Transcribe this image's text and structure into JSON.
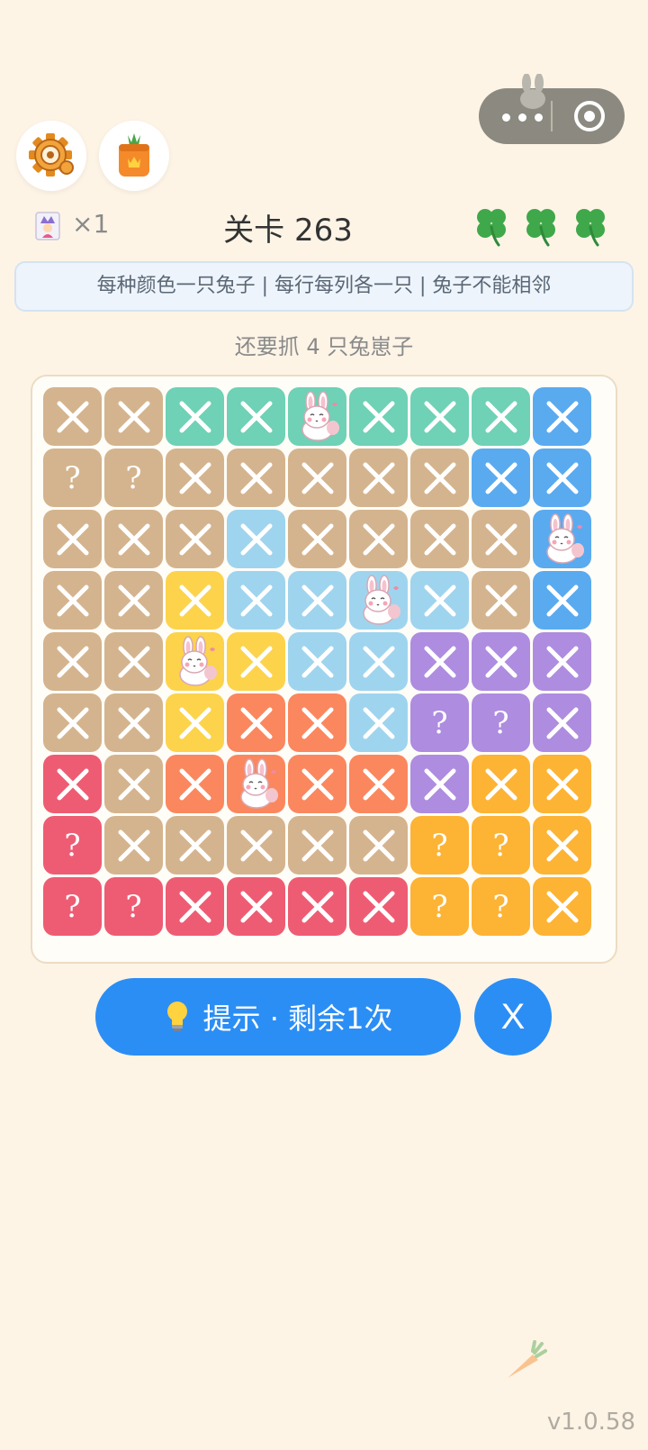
{
  "header": {
    "joker_count": "×1",
    "level_title": "关卡 263",
    "lives": 3
  },
  "rules": "每种颜色一只兔子 | 每行每列各一只 | 兔子不能相邻",
  "remaining": "还要抓 4 只兔崽子",
  "board": {
    "palette": {
      "T": "#d4b48e",
      "G": "#6fd1b5",
      "B": "#5aaaf0",
      "L": "#9fd4ee",
      "Y": "#fcd34b",
      "P": "#ae8ce0",
      "O": "#fb875e",
      "R": "#ee5c73",
      "A": "#fdb334"
    },
    "colors": [
      [
        "T",
        "T",
        "G",
        "G",
        "G",
        "G",
        "G",
        "G",
        "B"
      ],
      [
        "T",
        "T",
        "T",
        "T",
        "T",
        "T",
        "T",
        "B",
        "B"
      ],
      [
        "T",
        "T",
        "T",
        "L",
        "T",
        "T",
        "T",
        "T",
        "B"
      ],
      [
        "T",
        "T",
        "Y",
        "L",
        "L",
        "L",
        "L",
        "T",
        "B"
      ],
      [
        "T",
        "T",
        "Y",
        "Y",
        "L",
        "L",
        "P",
        "P",
        "P"
      ],
      [
        "T",
        "T",
        "Y",
        "O",
        "O",
        "L",
        "P",
        "P",
        "P"
      ],
      [
        "R",
        "T",
        "O",
        "O",
        "O",
        "O",
        "P",
        "A",
        "A"
      ],
      [
        "R",
        "T",
        "T",
        "T",
        "T",
        "T",
        "A",
        "A",
        "A"
      ],
      [
        "R",
        "R",
        "R",
        "R",
        "R",
        "R",
        "A",
        "A",
        "A"
      ]
    ],
    "states": [
      [
        "x",
        "x",
        "x",
        "x",
        "b",
        "x",
        "x",
        "x",
        "x"
      ],
      [
        "q",
        "q",
        "x",
        "x",
        "x",
        "x",
        "x",
        "x",
        "x"
      ],
      [
        "x",
        "x",
        "x",
        "x",
        "x",
        "x",
        "x",
        "x",
        "b"
      ],
      [
        "x",
        "x",
        "x",
        "x",
        "x",
        "b",
        "x",
        "x",
        "x"
      ],
      [
        "x",
        "x",
        "b",
        "x",
        "x",
        "x",
        "x",
        "x",
        "x"
      ],
      [
        "x",
        "x",
        "x",
        "x",
        "x",
        "x",
        "q",
        "q",
        "x"
      ],
      [
        "x",
        "x",
        "x",
        "b",
        "x",
        "x",
        "x",
        "x",
        "x"
      ],
      [
        "q",
        "x",
        "x",
        "x",
        "x",
        "x",
        "q",
        "q",
        "x"
      ],
      [
        "q",
        "q",
        "x",
        "x",
        "x",
        "x",
        "q",
        "q",
        "x"
      ]
    ]
  },
  "hint_button": {
    "label": "提示 · 剩余1次"
  },
  "close_button": {
    "label": "X"
  },
  "version": "v1.0.58"
}
